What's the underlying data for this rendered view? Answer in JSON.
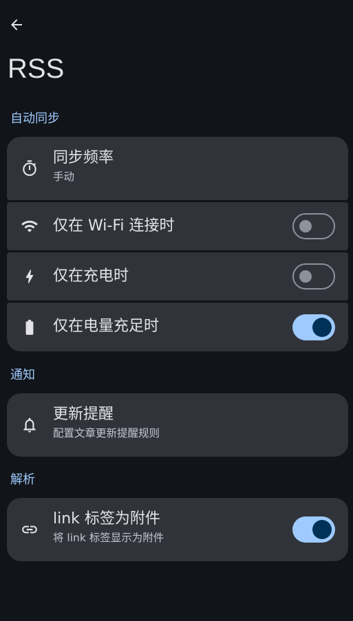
{
  "app": {
    "title": "RSS"
  },
  "topbar": {
    "back_icon": "arrow-back-icon"
  },
  "sections": {
    "sync": {
      "header": "自动同步",
      "items": [
        {
          "label": "同步频率",
          "sub": "手动",
          "icon": "timer-icon"
        },
        {
          "label": "仅在 Wi-Fi 连接时",
          "icon": "wifi-icon",
          "toggle": false
        },
        {
          "label": "仅在充电时",
          "icon": "bolt-icon",
          "toggle": false
        },
        {
          "label": "仅在电量充足时",
          "icon": "battery-icon",
          "toggle": true
        }
      ]
    },
    "notify": {
      "header": "通知",
      "items": [
        {
          "label": "更新提醒",
          "sub": "配置文章更新提醒规则",
          "icon": "bell-icon"
        }
      ]
    },
    "parse": {
      "header": "解析",
      "items": [
        {
          "label": "link 标签为附件",
          "sub": "将 link 标签显示为附件",
          "icon": "link-icon",
          "toggle": true
        }
      ]
    }
  },
  "colors": {
    "background": "#111418",
    "card": "#30343a",
    "accent": "#9ecaff",
    "knob_on": "#003258",
    "outline": "#8d9199"
  }
}
